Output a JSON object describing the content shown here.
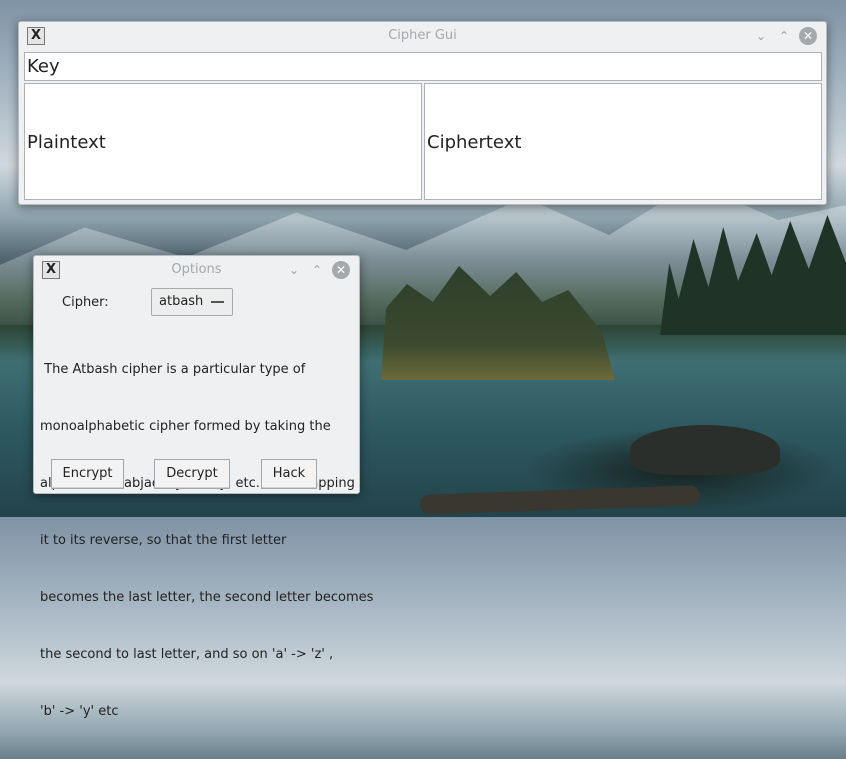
{
  "main_window": {
    "title": "Cipher Gui",
    "app_icon": "x-app-icon",
    "key_placeholder": "Key",
    "plaintext_placeholder": "Plaintext",
    "ciphertext_placeholder": "Ciphertext"
  },
  "options_window": {
    "title": "Options",
    "cipher_label": "Cipher:",
    "cipher_selected": "atbash",
    "description_lines": [
      " The Atbash cipher is a particular type of",
      "monoalphabetic cipher formed by taking the",
      "alphabet (or abjad, syllabary, etc.) and mapping",
      "it to its reverse, so that the first letter",
      "becomes the last letter, the second letter becomes",
      "the second to last letter, and so on 'a' -> 'z' ,",
      "'b' -> 'y' etc"
    ],
    "buttons": {
      "encrypt": "Encrypt",
      "decrypt": "Decrypt",
      "hack": "Hack"
    }
  },
  "icons": {
    "minimize": "chevron-down-icon",
    "maximize": "chevron-up-icon",
    "close": "close-icon",
    "combo_arrow": "dropdown-arrow-icon"
  }
}
